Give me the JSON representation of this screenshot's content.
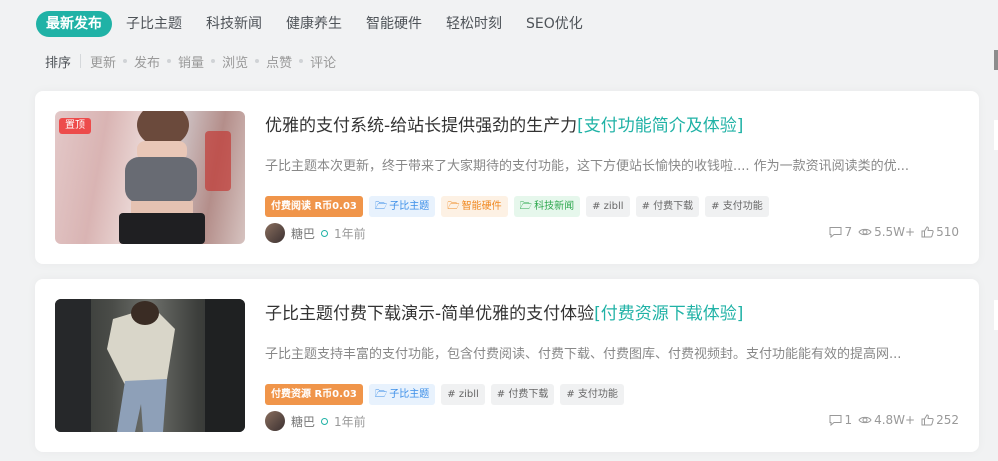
{
  "tabs": [
    {
      "label": "最新发布"
    },
    {
      "label": "子比主题"
    },
    {
      "label": "科技新闻"
    },
    {
      "label": "健康养生"
    },
    {
      "label": "智能硬件"
    },
    {
      "label": "轻松时刻"
    },
    {
      "label": "SEO优化"
    }
  ],
  "sort": {
    "label": "排序",
    "items": [
      "更新",
      "发布",
      "销量",
      "浏览",
      "点赞",
      "评论"
    ]
  },
  "posts": [
    {
      "pin_label": "置顶",
      "title": "优雅的支付系统-给站长提供强劲的生产力",
      "title_highlight": "[支付功能简介及体验]",
      "excerpt": "子比主题本次更新，终于带来了大家期待的支付功能，这下方便站长愉快的收钱啦.... 作为一款资讯阅读类的优...",
      "pay_tag": "付费阅读 R币0.03",
      "tags": [
        {
          "label": "子比主题",
          "icon": "folder-icon"
        },
        {
          "label": "智能硬件",
          "icon": "folder-icon"
        },
        {
          "label": "科技新闻",
          "icon": "folder-icon"
        },
        {
          "label": "# zibll"
        },
        {
          "label": "# 付费下载"
        },
        {
          "label": "# 支付功能"
        }
      ],
      "author": "糖巴",
      "time": "1年前",
      "comments": "7",
      "views": "5.5W+",
      "likes": "510"
    },
    {
      "title": "子比主题付费下载演示-简单优雅的支付体验",
      "title_highlight": "[付费资源下载体验]",
      "excerpt": "子比主题支持丰富的支付功能，包含付费阅读、付费下载、付费图库、付费视频封。支付功能能有效的提高网...",
      "pay_tag": "付费资源 R币0.03",
      "tags": [
        {
          "label": "子比主题",
          "icon": "folder-icon"
        },
        {
          "label": "# zibll"
        },
        {
          "label": "# 付费下载"
        },
        {
          "label": "# 支付功能"
        }
      ],
      "author": "糖巴",
      "time": "1年前",
      "comments": "1",
      "views": "4.8W+",
      "likes": "252"
    }
  ],
  "colors": {
    "accent": "#20b2a6",
    "pin": "#ed4b4b",
    "pay": "#f0954a"
  }
}
